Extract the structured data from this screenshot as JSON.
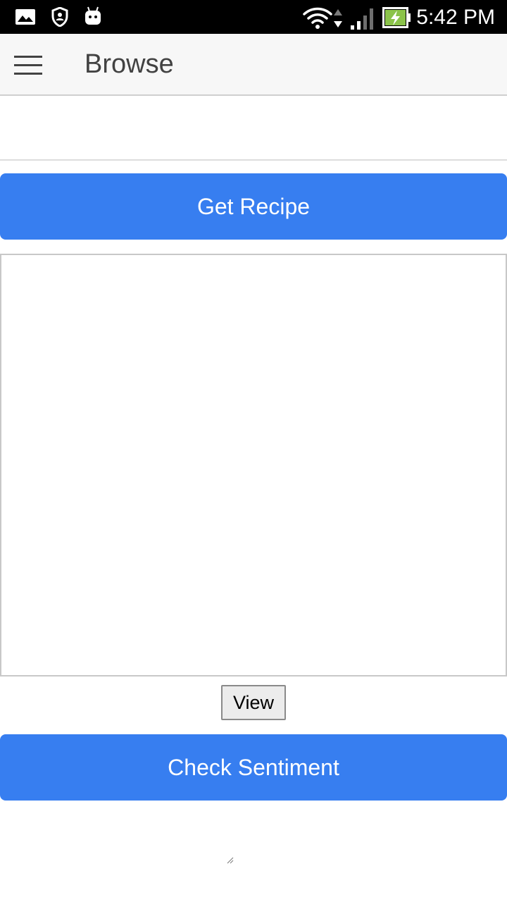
{
  "status_bar": {
    "time": "5:42 PM",
    "left_icons": [
      "gallery-icon",
      "shield-icon",
      "android-icon"
    ],
    "right_icons": [
      "wifi-icon",
      "data-arrows-icon",
      "signal-icon",
      "battery-charging-icon"
    ]
  },
  "app_bar": {
    "menu_icon": "hamburger-menu-icon",
    "title": "Browse"
  },
  "form": {
    "input_value": "",
    "input_placeholder": "",
    "get_recipe_label": "Get Recipe",
    "recipe_output": "",
    "view_label": "View",
    "check_sentiment_label": "Check Sentiment"
  },
  "colors": {
    "accent": "#377ef0",
    "app_bar_bg": "#f7f7f7",
    "title_text": "#424242",
    "battery_green": "#8bc34a"
  }
}
